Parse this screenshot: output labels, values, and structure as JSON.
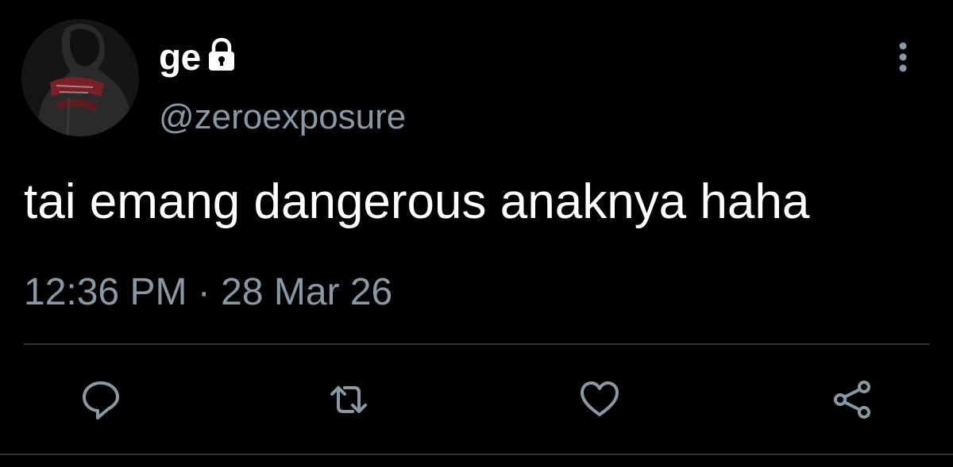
{
  "tweet": {
    "display_name": "ge",
    "handle": "@zeroexposure",
    "text": "tai emang dangerous anaknya haha",
    "timestamp": "12:36 PM · 28 Mar 26"
  },
  "icons": {
    "lock": "lock-icon",
    "more": "more-vertical-icon",
    "reply": "reply-icon",
    "retweet": "retweet-icon",
    "like": "heart-icon",
    "share": "share-icon"
  },
  "colors": {
    "background": "#000000",
    "primary_text": "#ffffff",
    "secondary_text": "#8899a6",
    "divider": "#2f3336"
  }
}
